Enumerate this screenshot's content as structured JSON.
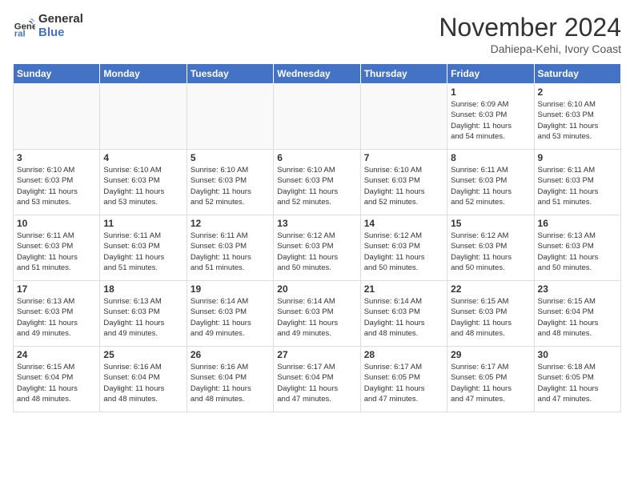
{
  "header": {
    "logo_general": "General",
    "logo_blue": "Blue",
    "month_year": "November 2024",
    "location": "Dahiepa-Kehi, Ivory Coast"
  },
  "days_of_week": [
    "Sunday",
    "Monday",
    "Tuesday",
    "Wednesday",
    "Thursday",
    "Friday",
    "Saturday"
  ],
  "weeks": [
    [
      {
        "day": "",
        "info": ""
      },
      {
        "day": "",
        "info": ""
      },
      {
        "day": "",
        "info": ""
      },
      {
        "day": "",
        "info": ""
      },
      {
        "day": "",
        "info": ""
      },
      {
        "day": "1",
        "info": "Sunrise: 6:09 AM\nSunset: 6:03 PM\nDaylight: 11 hours\nand 54 minutes."
      },
      {
        "day": "2",
        "info": "Sunrise: 6:10 AM\nSunset: 6:03 PM\nDaylight: 11 hours\nand 53 minutes."
      }
    ],
    [
      {
        "day": "3",
        "info": "Sunrise: 6:10 AM\nSunset: 6:03 PM\nDaylight: 11 hours\nand 53 minutes."
      },
      {
        "day": "4",
        "info": "Sunrise: 6:10 AM\nSunset: 6:03 PM\nDaylight: 11 hours\nand 53 minutes."
      },
      {
        "day": "5",
        "info": "Sunrise: 6:10 AM\nSunset: 6:03 PM\nDaylight: 11 hours\nand 52 minutes."
      },
      {
        "day": "6",
        "info": "Sunrise: 6:10 AM\nSunset: 6:03 PM\nDaylight: 11 hours\nand 52 minutes."
      },
      {
        "day": "7",
        "info": "Sunrise: 6:10 AM\nSunset: 6:03 PM\nDaylight: 11 hours\nand 52 minutes."
      },
      {
        "day": "8",
        "info": "Sunrise: 6:11 AM\nSunset: 6:03 PM\nDaylight: 11 hours\nand 52 minutes."
      },
      {
        "day": "9",
        "info": "Sunrise: 6:11 AM\nSunset: 6:03 PM\nDaylight: 11 hours\nand 51 minutes."
      }
    ],
    [
      {
        "day": "10",
        "info": "Sunrise: 6:11 AM\nSunset: 6:03 PM\nDaylight: 11 hours\nand 51 minutes."
      },
      {
        "day": "11",
        "info": "Sunrise: 6:11 AM\nSunset: 6:03 PM\nDaylight: 11 hours\nand 51 minutes."
      },
      {
        "day": "12",
        "info": "Sunrise: 6:11 AM\nSunset: 6:03 PM\nDaylight: 11 hours\nand 51 minutes."
      },
      {
        "day": "13",
        "info": "Sunrise: 6:12 AM\nSunset: 6:03 PM\nDaylight: 11 hours\nand 50 minutes."
      },
      {
        "day": "14",
        "info": "Sunrise: 6:12 AM\nSunset: 6:03 PM\nDaylight: 11 hours\nand 50 minutes."
      },
      {
        "day": "15",
        "info": "Sunrise: 6:12 AM\nSunset: 6:03 PM\nDaylight: 11 hours\nand 50 minutes."
      },
      {
        "day": "16",
        "info": "Sunrise: 6:13 AM\nSunset: 6:03 PM\nDaylight: 11 hours\nand 50 minutes."
      }
    ],
    [
      {
        "day": "17",
        "info": "Sunrise: 6:13 AM\nSunset: 6:03 PM\nDaylight: 11 hours\nand 49 minutes."
      },
      {
        "day": "18",
        "info": "Sunrise: 6:13 AM\nSunset: 6:03 PM\nDaylight: 11 hours\nand 49 minutes."
      },
      {
        "day": "19",
        "info": "Sunrise: 6:14 AM\nSunset: 6:03 PM\nDaylight: 11 hours\nand 49 minutes."
      },
      {
        "day": "20",
        "info": "Sunrise: 6:14 AM\nSunset: 6:03 PM\nDaylight: 11 hours\nand 49 minutes."
      },
      {
        "day": "21",
        "info": "Sunrise: 6:14 AM\nSunset: 6:03 PM\nDaylight: 11 hours\nand 48 minutes."
      },
      {
        "day": "22",
        "info": "Sunrise: 6:15 AM\nSunset: 6:03 PM\nDaylight: 11 hours\nand 48 minutes."
      },
      {
        "day": "23",
        "info": "Sunrise: 6:15 AM\nSunset: 6:04 PM\nDaylight: 11 hours\nand 48 minutes."
      }
    ],
    [
      {
        "day": "24",
        "info": "Sunrise: 6:15 AM\nSunset: 6:04 PM\nDaylight: 11 hours\nand 48 minutes."
      },
      {
        "day": "25",
        "info": "Sunrise: 6:16 AM\nSunset: 6:04 PM\nDaylight: 11 hours\nand 48 minutes."
      },
      {
        "day": "26",
        "info": "Sunrise: 6:16 AM\nSunset: 6:04 PM\nDaylight: 11 hours\nand 48 minutes."
      },
      {
        "day": "27",
        "info": "Sunrise: 6:17 AM\nSunset: 6:04 PM\nDaylight: 11 hours\nand 47 minutes."
      },
      {
        "day": "28",
        "info": "Sunrise: 6:17 AM\nSunset: 6:05 PM\nDaylight: 11 hours\nand 47 minutes."
      },
      {
        "day": "29",
        "info": "Sunrise: 6:17 AM\nSunset: 6:05 PM\nDaylight: 11 hours\nand 47 minutes."
      },
      {
        "day": "30",
        "info": "Sunrise: 6:18 AM\nSunset: 6:05 PM\nDaylight: 11 hours\nand 47 minutes."
      }
    ]
  ]
}
